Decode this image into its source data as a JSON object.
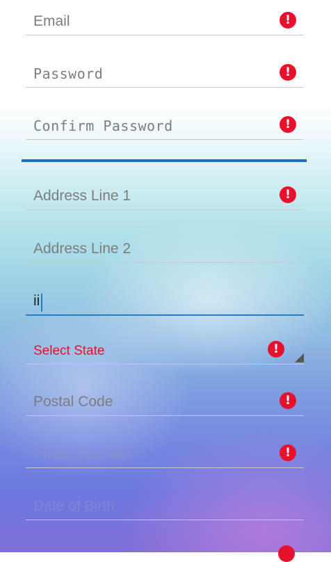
{
  "form": {
    "email": {
      "placeholder": "Email",
      "error_icon": "alert-circle-icon"
    },
    "password": {
      "placeholder": "Password",
      "error_icon": "alert-circle-icon"
    },
    "confirm_password": {
      "placeholder": "Confirm Password",
      "error_icon": "alert-circle-icon"
    },
    "address_line_1": {
      "placeholder": "Address Line 1",
      "error_icon": "alert-circle-icon"
    },
    "address_line_2": {
      "placeholder": "Address Line 2"
    },
    "city": {
      "value": "ii"
    },
    "state": {
      "placeholder": "Select State",
      "error_icon": "alert-circle-icon"
    },
    "postal_code": {
      "placeholder": "Postal Code",
      "error_icon": "alert-circle-icon"
    },
    "phone_number": {
      "placeholder": "Phone Number",
      "error_icon": "alert-circle-icon"
    },
    "date_of_birth": {
      "placeholder": "Date of Birth"
    }
  },
  "error_glyph": "!",
  "colors": {
    "error": "#e8112d",
    "accent": "#1f6fbf",
    "state_label": "#e8112d"
  }
}
